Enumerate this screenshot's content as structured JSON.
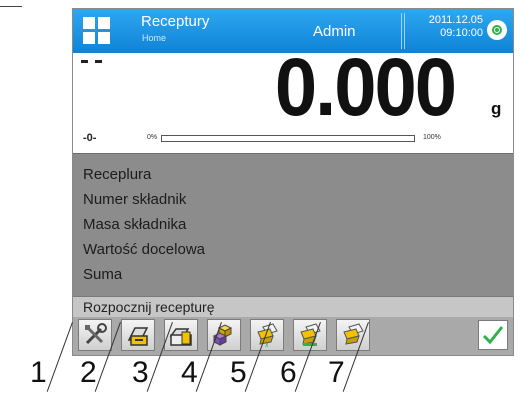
{
  "header": {
    "title": "Receptury",
    "subtitle": "Home",
    "user": "Admin",
    "date": "2011.12.05",
    "time": "09:10:00"
  },
  "weighing": {
    "value": "0.000",
    "unit": "g",
    "zero_indicator": "-0-",
    "bar_min_label": "0%",
    "bar_max_label": "100%",
    "bar_progress": 0
  },
  "info_lines": [
    "Receplura",
    "Numer składnik",
    "Masa składnika",
    "Wartość docelowa",
    "Suma"
  ],
  "prompt": "Rozpocznij recepturę",
  "toolbar": {
    "buttons": [
      {
        "icon": "settings-tools-icon"
      },
      {
        "icon": "database-record-icon"
      },
      {
        "icon": "database-record-icon"
      },
      {
        "icon": "ingredients-icon"
      },
      {
        "icon": "weight-multiply-icon"
      },
      {
        "icon": "weight-mass-icon"
      },
      {
        "icon": "weight-sum-icon"
      }
    ],
    "confirm_icon": "checkmark-icon"
  },
  "callouts": [
    "1",
    "2",
    "3",
    "4",
    "5",
    "6",
    "7"
  ],
  "colors": {
    "header_blue": "#1a94e4",
    "confirm_green": "#2fb24a"
  }
}
